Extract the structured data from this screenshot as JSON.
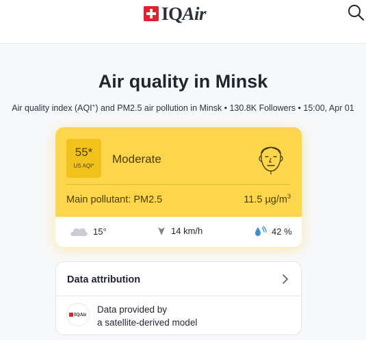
{
  "header": {
    "logo_text_iq": "IQ",
    "logo_text_air": "Air",
    "search_icon": "search-icon"
  },
  "page": {
    "title": "Air quality in Minsk",
    "subtitle_part1": "Air quality index (AQI",
    "subtitle_sup": "+",
    "subtitle_part2": ") and PM2.5 air pollution in Minsk • 130.8K Followers • 15:00, Apr 01"
  },
  "aqi_card": {
    "value": "55*",
    "unit": "US AQI*",
    "status": "Moderate",
    "face_icon": "face-moderate-icon",
    "pollutant_label": "Main pollutant: PM2.5",
    "concentration": "11.5 µg/m",
    "concentration_sup": "3",
    "accent_color": "#fdd64b",
    "box_color": "#f1c21b"
  },
  "weather": {
    "temperature": "15°",
    "temperature_icon": "cloud-icon",
    "wind": "14 km/h",
    "wind_icon": "wind-direction-icon",
    "humidity": "42 %",
    "humidity_icon": "humidity-icon"
  },
  "attribution": {
    "title": "Data attribution",
    "chevron_icon": "chevron-right-icon",
    "source_logo_text": "IQAir",
    "source_line1": "Data provided by",
    "source_line2": "a satellite-derived model"
  }
}
